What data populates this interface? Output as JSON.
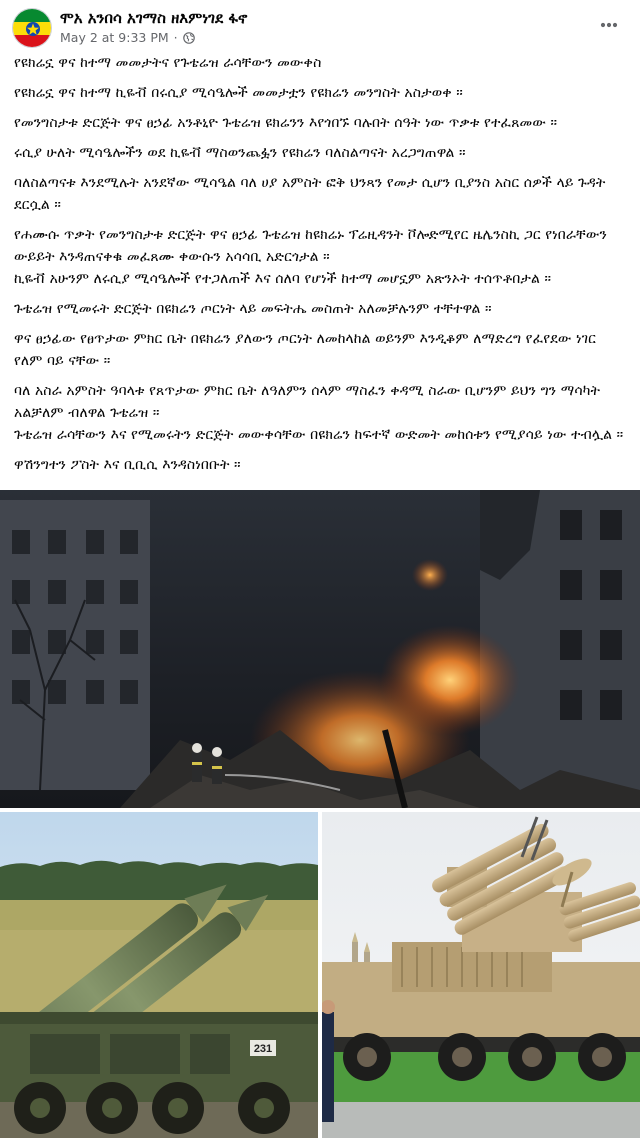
{
  "post": {
    "author": "ሞአ አንበሳ አገማስ ዘእምነገደ ፋኖ",
    "timestamp": "May 2 at 9:33 PM",
    "dot": "·",
    "paragraphs": [
      "የዩክሬኗ ዋና ከተማ መመታትና የጉቴሬዝ ራሳቸውን መውቀስ",
      "የዩክሬኗ ዋና ከተማ ኪዬቭ በሩሲያ ሚሳዔሎች መመታቷን የዩክሬን መንግስት አስታወቀ ።",
      "የመንግስታቱ ድርጅት ዋና ፀኃፊ አንቶኒዮ ጉቴሬዝ ዩክሬንን እየጎበኙ ባሉበት ሰዓት ነው ጥቃቱ የተፈጸመው ።",
      "ሩሲያ ሁለት ሚሳዔሎችን ወደ ኪዬቭ ማስወንጨፏን የዩክሬን ባለስልጣናት አረጋግጠዋል ።",
      "ባለስልጣናቱ እንደሚሉት አንደኛው ሚሳዔል ባለ ሀያ አምስት ፎቅ ህንጻን የመታ ሲሆን ቢያንስ አስር ሰዎች ላይ ጉዳት ደርሷል ።",
      "የሐሙሱ ጥቃት የመንግስታቱ ድርጅት ዋና ፀኃፊ ጉቴሬዝ ከዩክሬኑ ፕሬዚዳንት ቮሎድሚየር ዜሌንስኪ ጋር የነበራቸውን ውይይት እንዳጠናቀቁ መፈጸሙ ቀውሱን አሳሳቢ አድርጎታል ።",
      "ኪዬቭ አሁንም ለሩሲያ ሚሳዔሎች የተጋለጠች እና ሰለባ የሆነች ከተማ መሆኗም አጽንኦት ተሰጥቶበታል ።",
      "ጉቴሬዝ የሚመሩት ድርጅት በዩክሬን ጦርነት ላይ መፍትሔ መስጠት አለመቻሉንም ተቸተዋል ።",
      "ዋና ፀኃፊው የፀጥታው ምክር ቤት በዩክሬን ያለውን ጦርነት ለመከላከል ወይንም እንዲቆም ለማድረግ የፈየደው ነገር የለም ባይ ናቸው ።",
      "ባለ አስራ አምስት ዓባላቱ የጸጥታው ምክር ቤት ለዓለምን ሰላም ማስፈን ቀዳሚ ስራው ቢሆንም ይህን ግን ማሳካት አልቻለም ብለዋል ጉቴሬዝ ።",
      "ጉቴሬዝ ራሳቸውን እና የሚመሩትን ድርጅት መውቀሳቸው በዩክሬን ከፍተኛ ውድመት መከሰቱን የሚያሳይ ነው ተብሏል ።",
      "ዋሽንግተን ፖስት እና ቢቢሲ እንዳስነበቡት ።"
    ]
  },
  "icons": {
    "avatar": "ethiopian-flag-avatar",
    "audience": "globe-icon",
    "more": "more-options-icon"
  },
  "photos": [
    {
      "name": "burning-building-photo"
    },
    {
      "name": "missile-launcher-photo",
      "plate": "231"
    },
    {
      "name": "air-defense-system-photo"
    }
  ],
  "colors": {
    "text": "#050505",
    "secondary": "#65676b",
    "flag_green": "#078930",
    "flag_yellow": "#fcdd09",
    "flag_red": "#da121a",
    "flag_emblem": "#0f47af"
  }
}
